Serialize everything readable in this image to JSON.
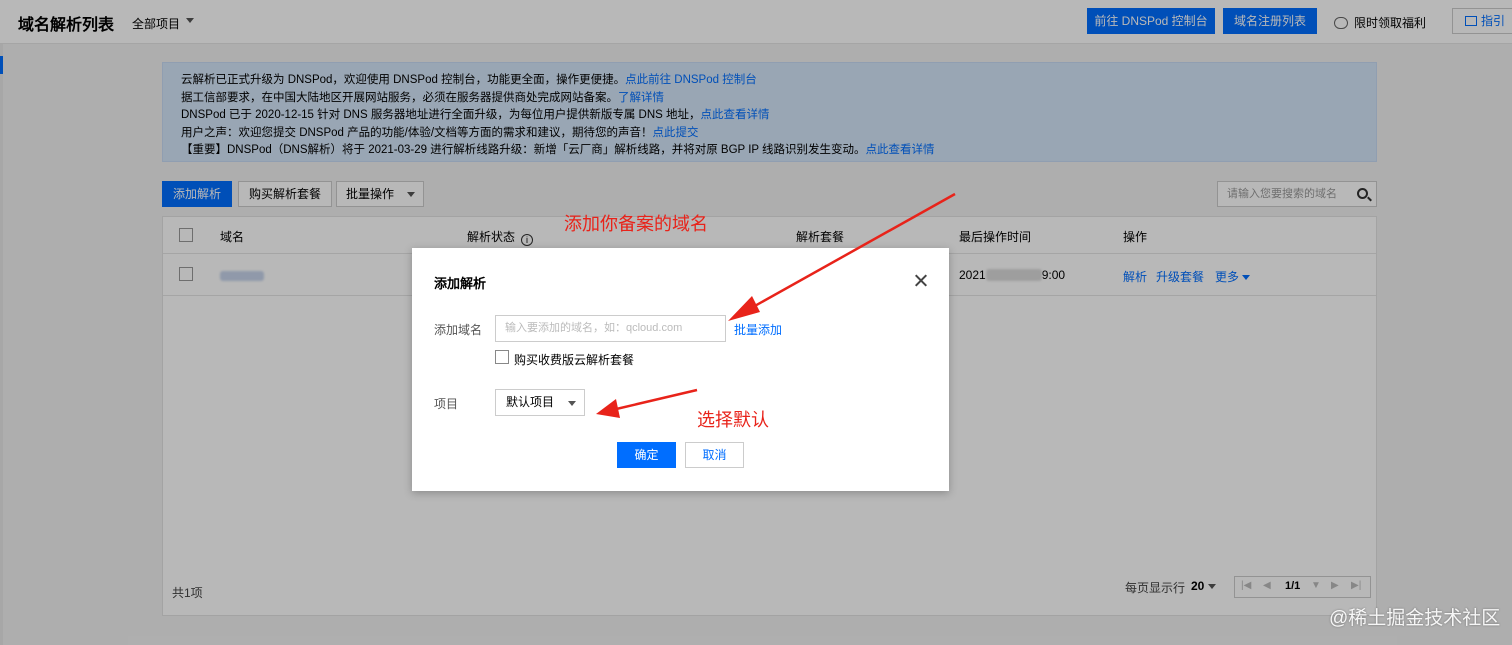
{
  "header": {
    "title": "域名解析列表",
    "project_select": "全部项目",
    "dnspod_button": "前往 DNSPod 控制台",
    "domain_list_button": "域名注册列表",
    "welfare_link": "限时领取福利",
    "guide_button": "指引"
  },
  "notice": {
    "lines": [
      {
        "text": "云解析已正式升级为 DNSPod，欢迎使用 DNSPod 控制台，功能更全面，操作更便捷。",
        "link": "点此前往 DNSPod 控制台"
      },
      {
        "text": "据工信部要求，在中国大陆地区开展网站服务，必须在服务器提供商处完成网站备案。",
        "link": "了解详情"
      },
      {
        "text": "DNSPod 已于 2020-12-15 针对 DNS 服务器地址进行全面升级，为每位用户提供新版专属 DNS 地址，",
        "link": "点此查看详情"
      },
      {
        "text": "用户之声：欢迎您提交 DNSPod 产品的功能/体验/文档等方面的需求和建议，期待您的声音！",
        "link": "点此提交"
      },
      {
        "text": "【重要】DNSPod（DNS解析）将于 2021-03-29 进行解析线路升级：新增「云厂商」解析线路，并将对原 BGP IP 线路识别发生变动。",
        "link": "点此查看详情"
      }
    ]
  },
  "toolbar": {
    "add_button": "添加解析",
    "buy_button": "购买解析套餐",
    "batch_select": "批量操作",
    "search_placeholder": "请输入您要搜索的域名"
  },
  "table": {
    "columns": [
      "域名",
      "解析状态",
      "解析套餐",
      "最后操作时间",
      "操作"
    ],
    "row": {
      "time_prefix": "2021",
      "time_suffix": "9:00",
      "actions": [
        "解析",
        "升级套餐",
        "更多"
      ]
    },
    "total": "共1项",
    "per_page_label": "每页显示行",
    "per_page_value": "20",
    "page": "1/1"
  },
  "dialog": {
    "title": "添加解析",
    "domain_label": "添加域名",
    "domain_placeholder": "输入要添加的域名，如：qcloud.com",
    "batch_add_link": "批量添加",
    "checkbox_label": "购买收费版云解析套餐",
    "project_label": "项目",
    "project_value": "默认项目",
    "ok_button": "确定",
    "cancel_button": "取消"
  },
  "annotations": {
    "domain_note": "添加你备案的域名",
    "project_note": "选择默认",
    "color": "#e8231a"
  },
  "watermark": "@稀土掘金技术社区",
  "colors": {
    "primary": "#006eff",
    "notice_bg": "#d5e7fa"
  }
}
